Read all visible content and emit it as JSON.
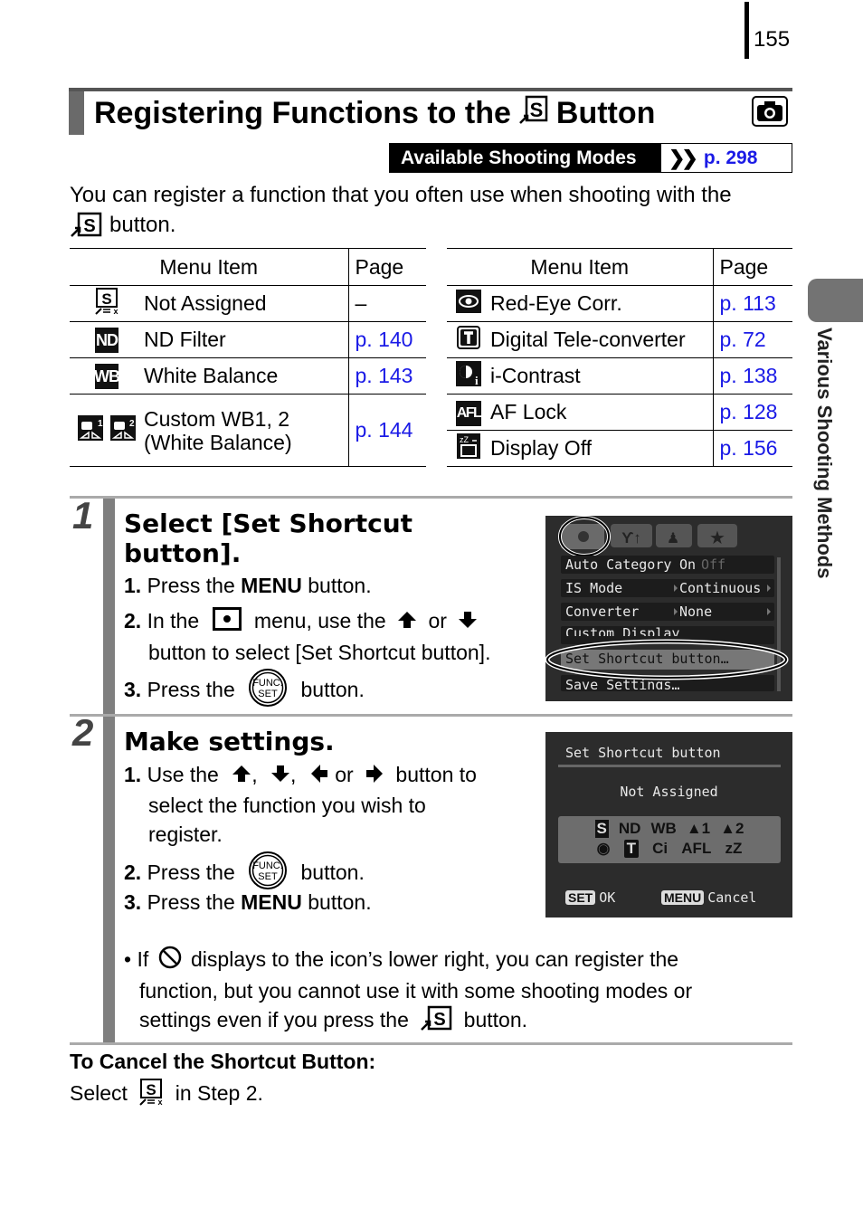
{
  "page_number": "155",
  "side_tab": {
    "label": "Various Shooting Methods"
  },
  "title": {
    "before_icon": "Registering Functions to the",
    "after_icon": "Button",
    "shortcut_icon": "shortcut-s-icon",
    "mode_icon": "camera-icon"
  },
  "available_modes": {
    "label": "Available Shooting Modes",
    "ref": "p. 298"
  },
  "intro": {
    "line1": "You can register a function that you often use when shooting with the",
    "line2": "button."
  },
  "table_left": {
    "headers": [
      "Menu Item",
      "Page"
    ],
    "rows": [
      {
        "icon": "not-assigned-icon",
        "item": "Not Assigned",
        "page": "–"
      },
      {
        "icon": "nd-filter-icon",
        "icon_text": "ND",
        "item": "ND Filter",
        "page": "p. 140"
      },
      {
        "icon": "white-balance-icon",
        "icon_text": "WB",
        "item": "White Balance",
        "page": "p. 143"
      },
      {
        "icon": "custom-wb-icon",
        "item_line1": "Custom WB1, 2",
        "item_line2": "(White Balance)",
        "page": "p. 144"
      }
    ]
  },
  "table_right": {
    "headers": [
      "Menu Item",
      "Page"
    ],
    "rows": [
      {
        "icon": "red-eye-icon",
        "item": "Red-Eye Corr.",
        "page": "p. 113"
      },
      {
        "icon": "tele-converter-icon",
        "icon_text": "T",
        "item": "Digital Tele-converter",
        "page": "p. 72"
      },
      {
        "icon": "i-contrast-icon",
        "item": "i-Contrast",
        "page": "p. 138"
      },
      {
        "icon": "af-lock-icon",
        "icon_text": "AFL",
        "item": "AF Lock",
        "page": "p. 128"
      },
      {
        "icon": "display-off-icon",
        "item": "Display Off",
        "page": "p. 156"
      }
    ]
  },
  "step1": {
    "number": "1",
    "heading_line1": "Select [Set Shortcut",
    "heading_line2": "button].",
    "items": [
      {
        "num": "1.",
        "pre": "Press the",
        "bold": "MENU",
        "post": "button."
      },
      {
        "num": "2.",
        "pre": "In the",
        "mid": "menu, use the",
        "or": "or",
        "line2": "button to select [Set Shortcut button]."
      },
      {
        "num": "3.",
        "pre": "Press the",
        "post": "button."
      }
    ],
    "screen": {
      "tabs": [
        "camera",
        "tools",
        "my-settings",
        "favorites"
      ],
      "rows": [
        {
          "label": "Auto Category",
          "value": "On",
          "value2": "Off"
        },
        {
          "label": "IS Mode",
          "value": "Continuous"
        },
        {
          "label": "Converter",
          "value": "None"
        },
        {
          "label": "Custom Display",
          "value": ""
        },
        {
          "label": "Set Shortcut button…",
          "value": "",
          "selected": true
        },
        {
          "label": "Save Settings…",
          "value": ""
        }
      ]
    }
  },
  "step2": {
    "number": "2",
    "heading": "Make settings.",
    "items": [
      {
        "num": "1.",
        "pre": "Use the",
        "sep1": ",",
        "sep2": ",",
        "or": "or",
        "post": "button to",
        "line2": "select the function you wish to",
        "line3": "register."
      },
      {
        "num": "2.",
        "pre": "Press the",
        "post": "button."
      },
      {
        "num": "3.",
        "pre": "Press the",
        "bold": "MENU",
        "post": "button."
      }
    ],
    "screen": {
      "title": "Set Shortcut button",
      "selected": "Not Assigned",
      "icons_row1": [
        "S",
        "ND",
        "WB",
        "▲1",
        "▲2"
      ],
      "icons_row2": [
        "◉",
        "T",
        "Ci",
        "AFL",
        "zZ"
      ],
      "ok_key": "SET",
      "ok_label": "OK",
      "cancel_key": "MENU",
      "cancel_label": "Cancel"
    },
    "note": {
      "pre": "If",
      "line1": "displays to the icon’s lower right, you can register the",
      "line2": "function, but you cannot use it with some shooting modes or",
      "line3": "settings even if you press the",
      "post": "button."
    }
  },
  "cancel_section": {
    "heading": "To Cancel the Shortcut Button:",
    "pre": "Select",
    "post": "in Step 2."
  },
  "colors": {
    "link": "#1a1ae6",
    "bar": "#7f7f7f",
    "lcd_bg": "#2c2c2c"
  }
}
